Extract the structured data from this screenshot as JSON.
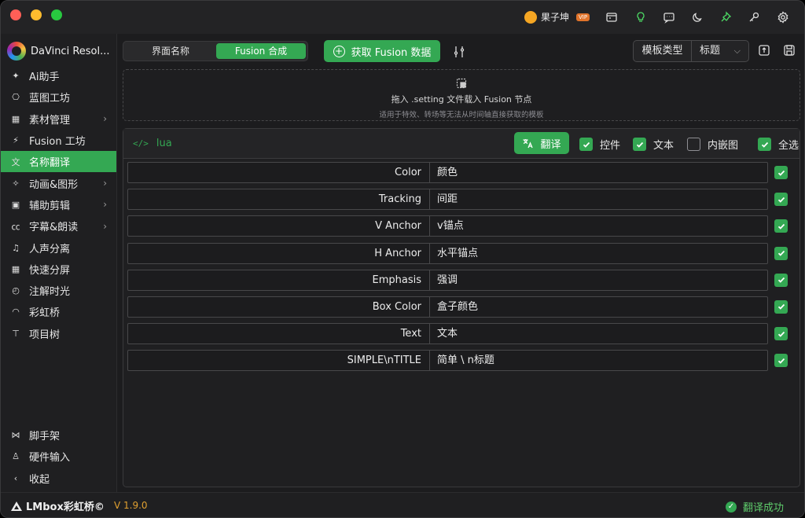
{
  "app": {
    "title": "DaVinci Resol...",
    "user": "果子坤",
    "vip_badge": "VIP",
    "version": "V 1.9.0",
    "footer_brand": "LMbox彩虹桥©",
    "status": "翻译成功"
  },
  "titlebar_icons": [
    "store-icon",
    "lightbulb-icon",
    "message-icon",
    "moon-icon",
    "pin-icon",
    "key-icon",
    "settings-icon"
  ],
  "sidebar": {
    "items": [
      {
        "label": "Ai助手",
        "icon": "sparkle-icon",
        "chevron": false
      },
      {
        "label": "蓝图工坊",
        "icon": "blueprint-icon",
        "chevron": false
      },
      {
        "label": "素材管理",
        "icon": "assets-icon",
        "chevron": true
      },
      {
        "label": "Fusion 工坊",
        "icon": "fusion-icon",
        "chevron": false
      },
      {
        "label": "名称翻译",
        "icon": "translate-icon",
        "chevron": false,
        "active": true
      },
      {
        "label": "动画&图形",
        "icon": "animation-icon",
        "chevron": true
      },
      {
        "label": "辅助剪辑",
        "icon": "clapper-icon",
        "chevron": true
      },
      {
        "label": "字幕&朗读",
        "icon": "caption-icon",
        "chevron": true
      },
      {
        "label": "人声分离",
        "icon": "voice-icon",
        "chevron": false
      },
      {
        "label": "快速分屏",
        "icon": "grid-icon",
        "chevron": false
      },
      {
        "label": "注解时光",
        "icon": "clock-icon",
        "chevron": false
      },
      {
        "label": "彩虹桥",
        "icon": "rainbow-icon",
        "chevron": false
      },
      {
        "label": "项目树",
        "icon": "tree-icon",
        "chevron": false
      }
    ],
    "bottom": [
      {
        "label": "脚手架",
        "icon": "scaffold-icon"
      },
      {
        "label": "硬件输入",
        "icon": "joystick-icon"
      },
      {
        "label": "收起",
        "icon": "chevron-left-icon"
      }
    ]
  },
  "toolbar": {
    "seg_a": "界面名称",
    "seg_b": "Fusion 合成",
    "fetch": "获取 Fusion 数据",
    "template_label": "模板类型",
    "template_value": "标题"
  },
  "dropzone": {
    "title": "拖入 .setting 文件载入 Fusion 节点",
    "subtitle": "适用于特效、转场等无法从时间轴直接获取的模板"
  },
  "panel": {
    "lang": "lua",
    "translate": "翻译",
    "filters": [
      {
        "label": "控件",
        "checked": true
      },
      {
        "label": "文本",
        "checked": true
      },
      {
        "label": "内嵌图",
        "checked": false
      },
      {
        "label": "全选",
        "checked": true
      }
    ],
    "rows": [
      {
        "src": "Color",
        "dst": "颜色",
        "checked": true
      },
      {
        "src": "Tracking",
        "dst": "间距",
        "checked": true
      },
      {
        "src": "V Anchor",
        "dst": "v锚点",
        "checked": true
      },
      {
        "src": "H Anchor",
        "dst": "水平锚点",
        "checked": true
      },
      {
        "src": "Emphasis",
        "dst": "强调",
        "checked": true
      },
      {
        "src": "Box Color",
        "dst": "盒子颜色",
        "checked": true
      },
      {
        "src": "Text",
        "dst": "文本",
        "checked": true
      },
      {
        "src": "SIMPLE\\nTITLE",
        "dst": "简单 \\ n标题",
        "checked": true
      }
    ]
  },
  "colors": {
    "accent": "#34a853",
    "version": "#e0a030",
    "background": "#1c1c1e"
  }
}
